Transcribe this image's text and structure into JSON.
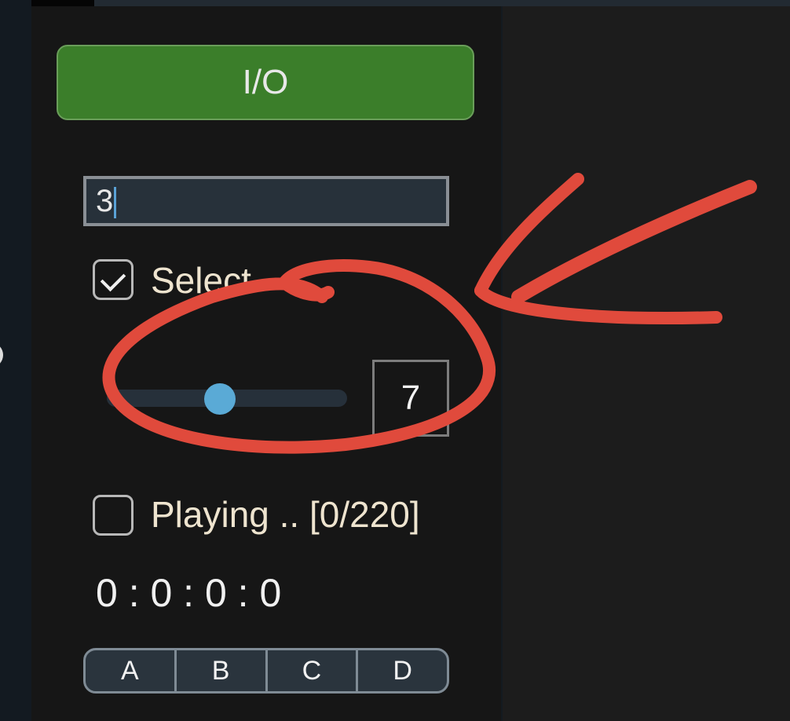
{
  "io_button": {
    "label": "I/O"
  },
  "text_input": {
    "value": "3"
  },
  "select_checkbox": {
    "label": "Select",
    "checked": true
  },
  "slider": {
    "value": 7,
    "position_fraction": 0.47
  },
  "playing_checkbox": {
    "label": "Playing .. [0/220]",
    "checked": false
  },
  "timer": {
    "text": "0 : 0 : 0 : 0"
  },
  "segments": [
    {
      "label": "A"
    },
    {
      "label": "B"
    },
    {
      "label": "C"
    },
    {
      "label": "D"
    }
  ],
  "colors": {
    "button_green": "#3b7e2a",
    "slider_accent": "#5aaad6",
    "annotation_red": "#e04a3c"
  }
}
